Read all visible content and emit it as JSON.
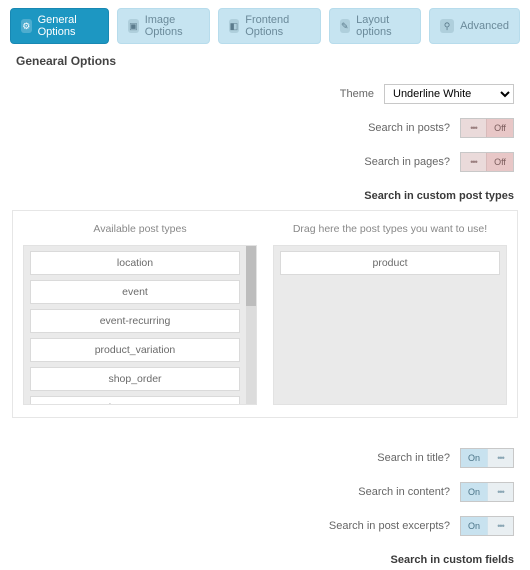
{
  "tabs": {
    "general": {
      "label": "General Options",
      "icon": "⚙"
    },
    "image": {
      "label": "Image Options",
      "icon": "▣"
    },
    "frontend": {
      "label": "Frontend Options",
      "icon": "◧"
    },
    "layout": {
      "label": "Layout options",
      "icon": "✎"
    },
    "advanced": {
      "label": "Advanced",
      "icon": "⚲"
    }
  },
  "section_title": "Genearal Options",
  "theme": {
    "label": "Theme",
    "selected": "Underline White",
    "options": [
      "Underline White"
    ]
  },
  "toggles": {
    "search_posts": {
      "label": "Search in posts?",
      "state": "Off"
    },
    "search_pages": {
      "label": "Search in pages?",
      "state": "Off"
    },
    "search_title": {
      "label": "Search in title?",
      "state": "On"
    },
    "search_content": {
      "label": "Search in content?",
      "state": "On"
    },
    "search_excerpts": {
      "label": "Search in post excerpts?",
      "state": "On"
    }
  },
  "cpt": {
    "header": "Search in custom post types",
    "available_title": "Available post types",
    "selected_title": "Drag here the post types you want to use!",
    "available": [
      "location",
      "event",
      "event-recurring",
      "product_variation",
      "shop_order",
      "shop_coupon"
    ],
    "selected": [
      "product"
    ]
  },
  "cf_header": "Search in custom fields"
}
